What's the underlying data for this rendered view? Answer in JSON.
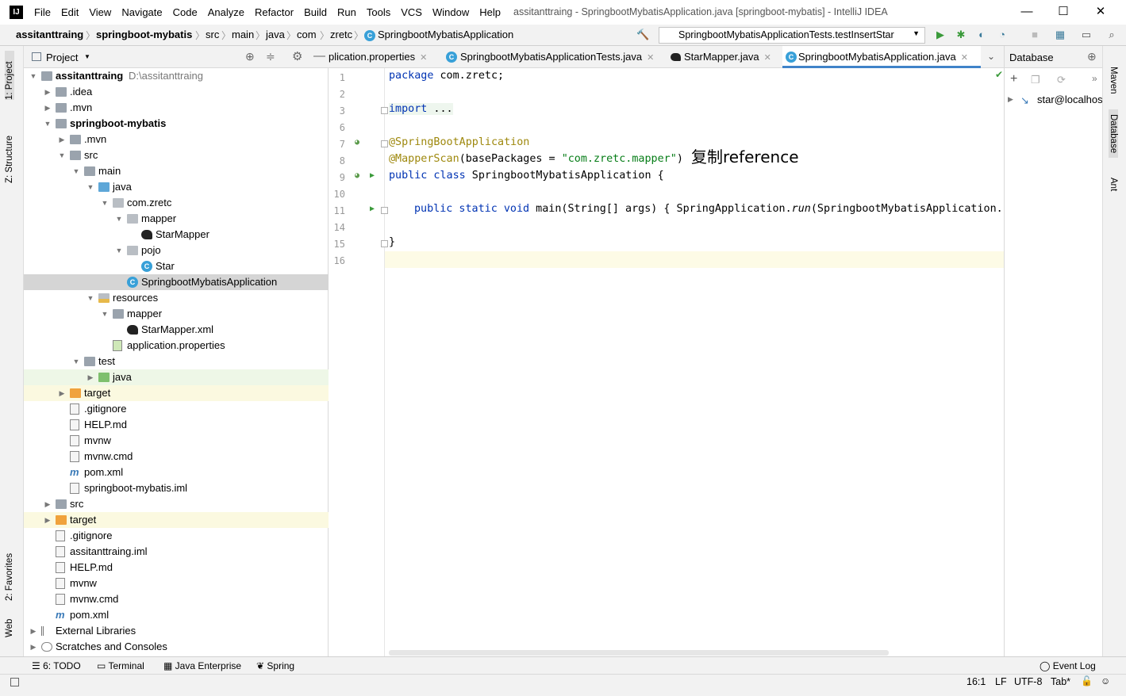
{
  "app": {
    "title": "assitanttraing - SpringbootMybatisApplication.java [springboot-mybatis] - IntelliJ IDEA",
    "logo_text": "IJ"
  },
  "menu": [
    "File",
    "Edit",
    "View",
    "Navigate",
    "Code",
    "Analyze",
    "Refactor",
    "Build",
    "Run",
    "Tools",
    "VCS",
    "Window",
    "Help"
  ],
  "breadcrumbs": [
    "assitanttraing",
    "springboot-mybatis",
    "src",
    "main",
    "java",
    "com",
    "zretc",
    "SpringbootMybatisApplication"
  ],
  "run_config": "SpringbootMybatisApplicationTests.testInsertStar",
  "left_tabs": {
    "project": "1: Project",
    "structure": "Z: Structure",
    "favorites": "2: Favorites",
    "web": "Web"
  },
  "project_panel": {
    "title": "Project"
  },
  "tree": [
    {
      "label": "assitanttraing",
      "extra": "D:\\assitanttraing",
      "bold": true
    },
    {
      "label": ".idea"
    },
    {
      "label": ".mvn"
    },
    {
      "label": "springboot-mybatis",
      "bold": true
    },
    {
      "label": ".mvn"
    },
    {
      "label": "src"
    },
    {
      "label": "main"
    },
    {
      "label": "java"
    },
    {
      "label": "com.zretc"
    },
    {
      "label": "mapper"
    },
    {
      "label": "StarMapper"
    },
    {
      "label": "pojo"
    },
    {
      "label": "Star"
    },
    {
      "label": "SpringbootMybatisApplication"
    },
    {
      "label": "resources"
    },
    {
      "label": "mapper"
    },
    {
      "label": "StarMapper.xml"
    },
    {
      "label": "application.properties"
    },
    {
      "label": "test"
    },
    {
      "label": "java"
    },
    {
      "label": "target"
    },
    {
      "label": ".gitignore"
    },
    {
      "label": "HELP.md"
    },
    {
      "label": "mvnw"
    },
    {
      "label": "mvnw.cmd"
    },
    {
      "label": "pom.xml"
    },
    {
      "label": "springboot-mybatis.iml"
    },
    {
      "label": "src"
    },
    {
      "label": "target"
    },
    {
      "label": ".gitignore"
    },
    {
      "label": "assitanttraing.iml"
    },
    {
      "label": "HELP.md"
    },
    {
      "label": "mvnw"
    },
    {
      "label": "mvnw.cmd"
    },
    {
      "label": "pom.xml"
    },
    {
      "label": "External Libraries"
    },
    {
      "label": "Scratches and Consoles"
    }
  ],
  "editor_tabs": [
    {
      "label": "plication.properties"
    },
    {
      "label": "SpringbootMybatisApplicationTests.java"
    },
    {
      "label": "StarMapper.java"
    },
    {
      "label": "SpringbootMybatisApplication.java",
      "active": true
    }
  ],
  "line_numbers": [
    "1",
    "2",
    "3",
    "6",
    "7",
    "8",
    "9",
    "10",
    "11",
    "14",
    "15",
    "16"
  ],
  "code": {
    "l1_kw": "package",
    "l1_rest": " com.zretc;",
    "l3_kw": "import",
    "l3_rest": " ...",
    "l7": "@SpringBootApplication",
    "l8_ann": "@MapperScan",
    "l8_mid": "(basePackages = ",
    "l8_str": "\"com.zretc.mapper\"",
    "l8_end": ")",
    "l9_kw": "public class",
    "l9_rest": " SpringbootMybatisApplication {",
    "l11_kw": "public static void",
    "l11_rest": " main(String[] args) { SpringApplication.",
    "l11_run": "run",
    "l11_tail": "(SpringbootMybatisApplication.c",
    "l15": "}"
  },
  "annotation_text": "复制reference",
  "db_panel": {
    "title": "Database",
    "item": "star@localhos"
  },
  "right_tabs": {
    "maven": "Maven",
    "database": "Database",
    "ant": "Ant"
  },
  "bottom_tools": {
    "todo": "6: TODO",
    "terminal": "Terminal",
    "java_enterprise": "Java Enterprise",
    "spring": "Spring",
    "event_log": "Event Log"
  },
  "status": {
    "position": "16:1",
    "line_sep": "LF",
    "encoding": "UTF-8",
    "indent": "Tab*"
  }
}
